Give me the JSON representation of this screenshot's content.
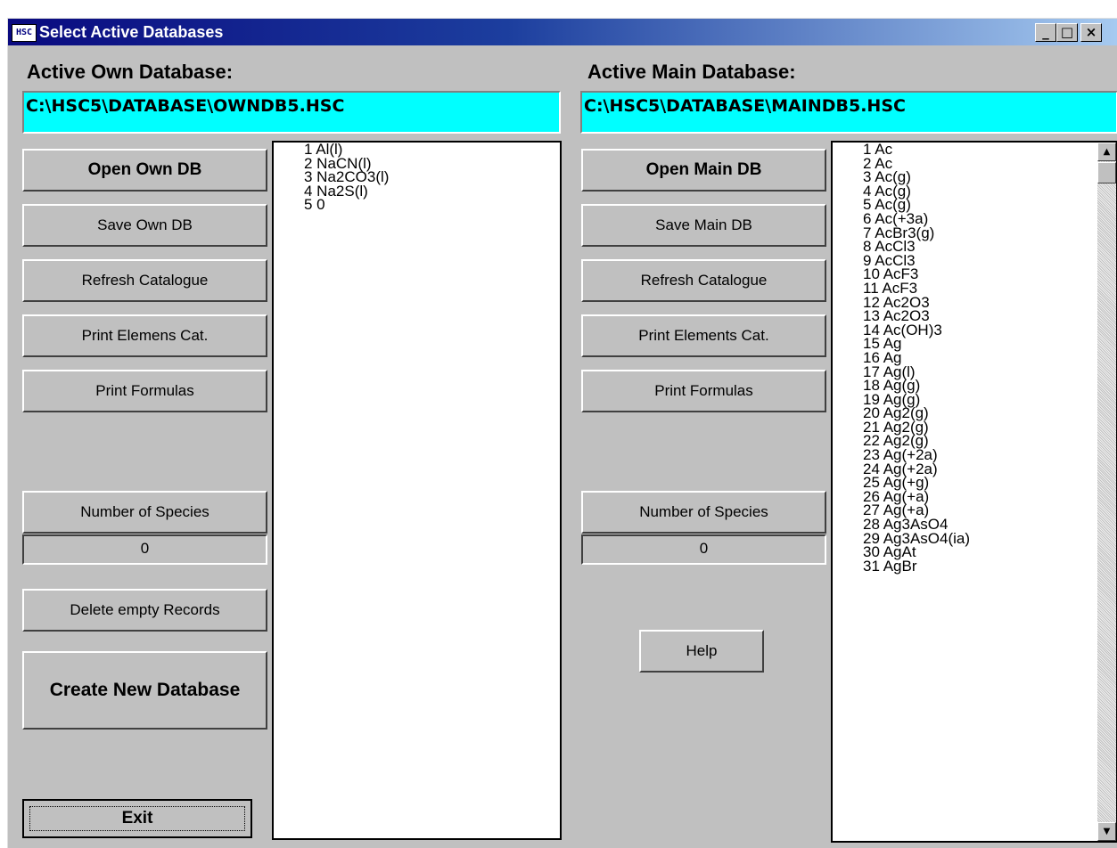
{
  "window": {
    "title": "Select Active Databases",
    "app_icon_text": "HSC",
    "controls": {
      "minimize": "_",
      "maximize": "□",
      "close": "×"
    }
  },
  "own": {
    "label": "Active Own Database:",
    "path": "C:\\HSC5\\DATABASE\\OWNDB5.HSC",
    "buttons": {
      "open": "Open Own DB",
      "save": "Save Own DB",
      "refresh": "Refresh Catalogue",
      "print_elements": "Print Elemens Cat.",
      "print_formulas": "Print Formulas",
      "number_species": "Number of Species",
      "delete_empty": "Delete empty Records",
      "create_new": "Create New Database",
      "exit": "Exit"
    },
    "species_count": "0",
    "items": [
      "1  Al(l)",
      "2  NaCN(l)",
      "3  Na2CO3(l)",
      "4  Na2S(l)",
      "5  0"
    ]
  },
  "main": {
    "label": "Active Main Database:",
    "path": "C:\\HSC5\\DATABASE\\MAINDB5.HSC",
    "buttons": {
      "open": "Open Main DB",
      "save": "Save Main DB",
      "refresh": "Refresh Catalogue",
      "print_elements": "Print Elements Cat.",
      "print_formulas": "Print Formulas",
      "number_species": "Number of Species",
      "help": "Help"
    },
    "species_count": "0",
    "items": [
      "1  Ac",
      "2  Ac",
      "3  Ac(g)",
      "4  Ac(g)",
      "5  Ac(g)",
      "6  Ac(+3a)",
      "7  AcBr3(g)",
      "8  AcCl3",
      "9  AcCl3",
      "10  AcF3",
      "11  AcF3",
      "12  Ac2O3",
      "13  Ac2O3",
      "14  Ac(OH)3",
      "15  Ag",
      "16  Ag",
      "17  Ag(l)",
      "18  Ag(g)",
      "19  Ag(g)",
      "20  Ag2(g)",
      "21  Ag2(g)",
      "22  Ag2(g)",
      "23  Ag(+2a)",
      "24  Ag(+2a)",
      "25  Ag(+g)",
      "26  Ag(+a)",
      "27  Ag(+a)",
      "28  Ag3AsO4",
      "29  Ag3AsO4(ia)",
      "30  AgAt",
      "31  AgBr"
    ],
    "scroll_up": "▲",
    "scroll_down": "▼"
  }
}
